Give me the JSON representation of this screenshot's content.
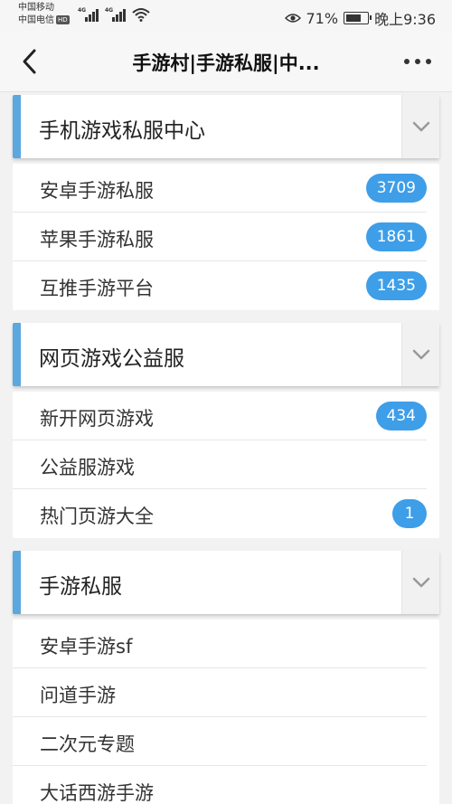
{
  "status_bar": {
    "carrier_1": "中国移动",
    "carrier_2": "中国电信",
    "hd_badge": "HD",
    "network_1": "4G",
    "network_2": "4G",
    "eye_icon": "eye-icon",
    "battery_percent": "71%",
    "battery_level": 0.71,
    "time": "晚上9:36"
  },
  "header": {
    "title": "手游村|手游私服|中...",
    "back_icon": "chevron-left-icon",
    "more_icon": "more-dots-icon"
  },
  "sections": [
    {
      "title": "手机游戏私服中心",
      "items": [
        {
          "label": "安卓手游私服",
          "count": "3709"
        },
        {
          "label": "苹果手游私服",
          "count": "1861"
        },
        {
          "label": "互推手游平台",
          "count": "1435"
        }
      ]
    },
    {
      "title": "网页游戏公益服",
      "items": [
        {
          "label": "新开网页游戏",
          "count": "434"
        },
        {
          "label": "公益服游戏",
          "count": ""
        },
        {
          "label": "热门页游大全",
          "count": "1"
        }
      ]
    },
    {
      "title": "手游私服",
      "items": [
        {
          "label": "安卓手游sf",
          "count": ""
        },
        {
          "label": "问道手游",
          "count": ""
        },
        {
          "label": "二次元专题",
          "count": ""
        },
        {
          "label": "大话西游手游",
          "count": ""
        }
      ]
    }
  ],
  "colors": {
    "accent": "#5ba8df",
    "badge": "#3e9ee8"
  }
}
